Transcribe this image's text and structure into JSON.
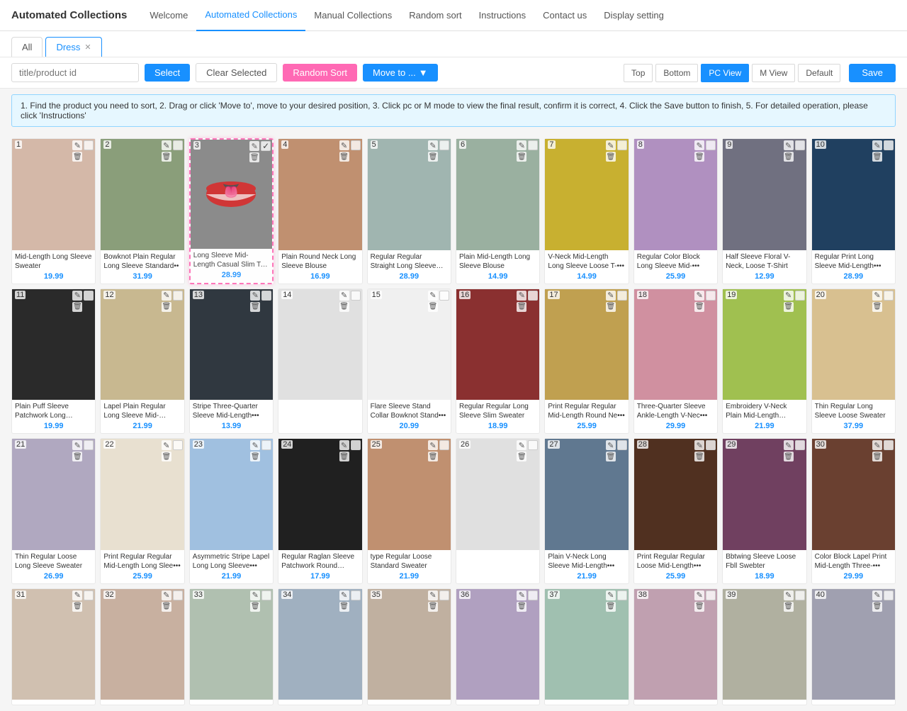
{
  "app": {
    "title": "Automated Collections"
  },
  "nav": {
    "items": [
      {
        "id": "welcome",
        "label": "Welcome",
        "active": false
      },
      {
        "id": "automated",
        "label": "Automated Collections",
        "active": true
      },
      {
        "id": "manual",
        "label": "Manual Collections",
        "active": false
      },
      {
        "id": "random",
        "label": "Random sort",
        "active": false
      },
      {
        "id": "instructions",
        "label": "Instructions",
        "active": false
      },
      {
        "id": "contact",
        "label": "Contact us",
        "active": false
      },
      {
        "id": "display",
        "label": "Display setting",
        "active": false
      }
    ]
  },
  "tabs": [
    {
      "id": "all",
      "label": "All",
      "active": false,
      "closable": false
    },
    {
      "id": "dress",
      "label": "Dress",
      "active": true,
      "closable": true
    }
  ],
  "toolbar": {
    "search_placeholder": "title/product id",
    "select_label": "Select",
    "clear_selected_label": "Clear Selected",
    "random_sort_label": "Random Sort",
    "move_to_label": "Move to ...",
    "top_label": "Top",
    "bottom_label": "Bottom",
    "pc_view_label": "PC View",
    "m_view_label": "M View",
    "default_label": "Default",
    "save_label": "Save"
  },
  "info_text": "1. Find the product you need to sort, 2. Drag or click 'Move to', move to your desired position, 3. Click pc or M mode to view the final result, confirm it is correct, 4. Click the Save button to finish, 5. For detailed operation, please click 'Instructions'",
  "products": [
    {
      "num": 1,
      "title": "Mid-Length Long Sleeve Sweater",
      "price": "19.99",
      "color": "#d4b8a8",
      "selected": false
    },
    {
      "num": 2,
      "title": "Bowknot Plain Regular Long Sleeve Standard••",
      "price": "31.99",
      "color": "#8a9e7a",
      "selected": false
    },
    {
      "num": 3,
      "title": "Long Sleeve Mid-Length Casual Slim T-Shirt",
      "price": "28.99",
      "color": "#b0a0b0",
      "selected": true,
      "dragging": true
    },
    {
      "num": 4,
      "title": "Plain Round Neck Long Sleeve Blouse",
      "price": "16.99",
      "color": "#c09070",
      "selected": false
    },
    {
      "num": 5,
      "title": "Regular Regular Straight Long Sleeve Blouse",
      "price": "28.99",
      "color": "#a0b5b0",
      "selected": false
    },
    {
      "num": 6,
      "title": "Plain Mid-Length Long Sleeve Blouse",
      "price": "14.99",
      "color": "#9ab0a0",
      "selected": false
    },
    {
      "num": 7,
      "title": "V-Neck Mid-Length Long Sleeve Loose T-•••",
      "price": "14.99",
      "color": "#c8b030",
      "selected": false
    },
    {
      "num": 8,
      "title": "Regular Color Block Long Sleeve Mid-•••",
      "price": "25.99",
      "color": "#b090c0",
      "selected": false
    },
    {
      "num": 9,
      "title": "Half Sleeve Floral V-Neck, Loose T-Shirt",
      "price": "12.99",
      "color": "#707080",
      "selected": false
    },
    {
      "num": 10,
      "title": "Regular Print Long Sleeve Mid-Length•••",
      "price": "28.99",
      "color": "#204060",
      "selected": false
    },
    {
      "num": 11,
      "title": "Plain Puff Sleeve Patchwork Long Sleeve•••",
      "price": "19.99",
      "color": "#2a2a2a",
      "selected": false
    },
    {
      "num": 12,
      "title": "Lapel Plain Regular Long Sleeve Mid-Length•••",
      "price": "21.99",
      "color": "#c8b890",
      "selected": false
    },
    {
      "num": 13,
      "title": "Stripe Three-Quarter Sleeve Mid-Length•••",
      "price": "13.99",
      "color": "#303840",
      "selected": false
    },
    {
      "num": 14,
      "title": "",
      "price": "",
      "color": "#e0e0e0",
      "selected": false,
      "empty": true
    },
    {
      "num": 15,
      "title": "Flare Sleeve Stand Collar Bowknot Stand•••",
      "price": "20.99",
      "color": "#f0f0f0",
      "selected": false
    },
    {
      "num": 16,
      "title": "Regular Regular Long Sleeve Slim Sweater",
      "price": "18.99",
      "color": "#8a3030",
      "selected": false
    },
    {
      "num": 17,
      "title": "Print Regular Regular Mid-Length Round Ne•••",
      "price": "25.99",
      "color": "#c0a050",
      "selected": false
    },
    {
      "num": 18,
      "title": "Three-Quarter Sleeve Ankle-Length V-Nec•••",
      "price": "29.99",
      "color": "#d090a0",
      "selected": false
    },
    {
      "num": 19,
      "title": "Embroidery V-Neck Plain Mid-Length Long•••",
      "price": "21.99",
      "color": "#a0c050",
      "selected": false
    },
    {
      "num": 20,
      "title": "Thin Regular Long Sleeve Loose Sweater",
      "price": "37.99",
      "color": "#d8c090",
      "selected": false
    },
    {
      "num": 21,
      "title": "Thin Regular Loose Long Sleeve Sweater",
      "price": "26.99",
      "color": "#b0a8c0",
      "selected": false
    },
    {
      "num": 22,
      "title": "Print Regular Regular Mid-Length Long Slee•••",
      "price": "25.99",
      "color": "#e8e0d0",
      "selected": false
    },
    {
      "num": 23,
      "title": "Asymmetric Stripe Lapel Long Long Sleeve•••",
      "price": "21.99",
      "color": "#a0c0e0",
      "selected": false
    },
    {
      "num": 24,
      "title": "Regular Raglan Sleeve Patchwork Round Nec•••",
      "price": "17.99",
      "color": "#202020",
      "selected": false
    },
    {
      "num": 25,
      "title": "type Regular Loose Standard Sweater",
      "price": "21.99",
      "color": "#c09070",
      "selected": false
    },
    {
      "num": 26,
      "title": "",
      "price": "",
      "color": "#e0e0e0",
      "selected": false,
      "empty": true
    },
    {
      "num": 27,
      "title": "Plain V-Neck Long Sleeve Mid-Length•••",
      "price": "21.99",
      "color": "#607890",
      "selected": false
    },
    {
      "num": 28,
      "title": "Print Regular Regular Loose Mid-Length•••",
      "price": "25.99",
      "color": "#503020",
      "selected": false
    },
    {
      "num": 29,
      "title": "Bbtwing Sleeve Loose Fbll Swebter",
      "price": "18.99",
      "color": "#704060",
      "selected": false
    },
    {
      "num": 30,
      "title": "Color Block Lapel Print Mid-Length Three-•••",
      "price": "29.99",
      "color": "#6a4030",
      "selected": false
    },
    {
      "num": 31,
      "title": "",
      "price": "",
      "color": "#d0c0b0",
      "selected": false
    },
    {
      "num": 32,
      "title": "",
      "price": "",
      "color": "#c8b0a0",
      "selected": false
    },
    {
      "num": 33,
      "title": "",
      "price": "",
      "color": "#b0c0b0",
      "selected": false
    },
    {
      "num": 34,
      "title": "",
      "price": "",
      "color": "#a0b0c0",
      "selected": false
    },
    {
      "num": 35,
      "title": "",
      "price": "",
      "color": "#c0b0a0",
      "selected": false
    },
    {
      "num": 36,
      "title": "",
      "price": "",
      "color": "#b0a0c0",
      "selected": false
    },
    {
      "num": 37,
      "title": "",
      "price": "",
      "color": "#a0c0b0",
      "selected": false
    },
    {
      "num": 38,
      "title": "",
      "price": "",
      "color": "#c0a0b0",
      "selected": false
    },
    {
      "num": 39,
      "title": "",
      "price": "",
      "color": "#b0b0a0",
      "selected": false
    },
    {
      "num": 40,
      "title": "",
      "price": "",
      "color": "#a0a0b0",
      "selected": false
    }
  ]
}
